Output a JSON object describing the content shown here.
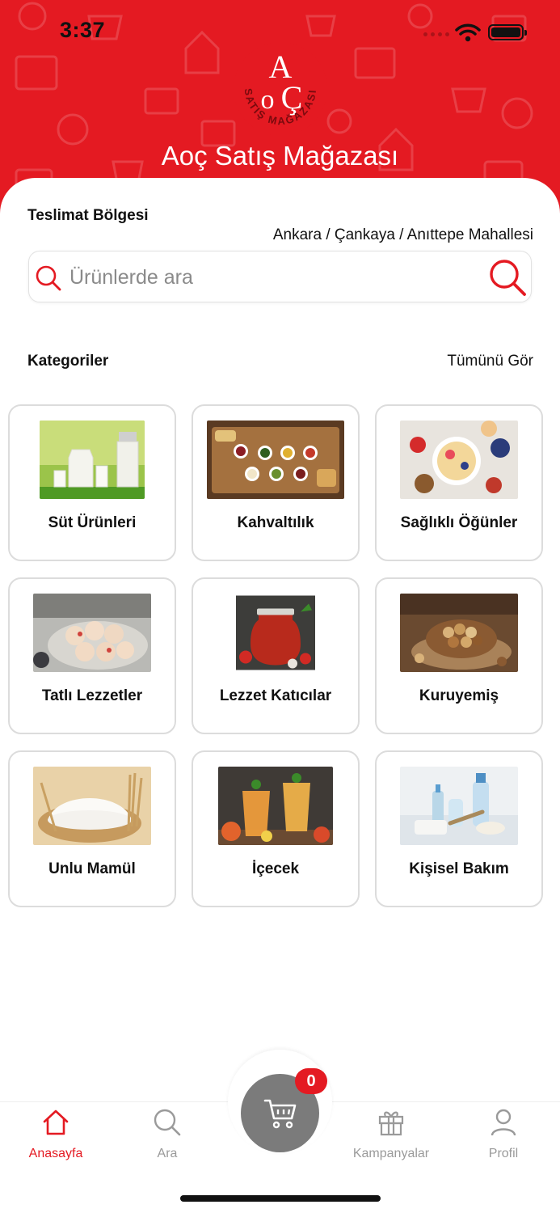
{
  "status_bar": {
    "time": "3:37"
  },
  "header": {
    "logo_text": {
      "monogram": "AOÇ",
      "ring": "SATIŞ MAĞAZASI"
    },
    "title": "Aoç Satış Mağazası",
    "brand_color": "#e41a22"
  },
  "delivery": {
    "title": "Teslimat Bölgesi",
    "address": "Ankara  / Çankaya / Anıttepe Mahallesi"
  },
  "search": {
    "placeholder": "Ürünlerde ara",
    "value": ""
  },
  "categories": {
    "title": "Kategoriler",
    "see_all": "Tümünü Gör",
    "items": [
      {
        "label": "Süt Ürünleri",
        "image": "milk-products-image"
      },
      {
        "label": "Kahvaltılık",
        "image": "breakfast-image"
      },
      {
        "label": "Sağlıklı Öğünler",
        "image": "healthy-meals-image"
      },
      {
        "label": "Tatlı Lezzetler",
        "image": "sweets-image"
      },
      {
        "label": "Lezzet Katıcılar",
        "image": "condiments-image"
      },
      {
        "label": "Kuruyemiş",
        "image": "nuts-image"
      },
      {
        "label": "Unlu Mamül",
        "image": "flour-products-image"
      },
      {
        "label": "İçecek",
        "image": "drinks-image"
      },
      {
        "label": "Kişisel Bakım",
        "image": "personal-care-image"
      }
    ]
  },
  "tabbar": {
    "tabs": [
      {
        "label": "Anasayfa",
        "icon": "home-icon",
        "active": true
      },
      {
        "label": "Ara",
        "icon": "search-icon",
        "active": false
      },
      {
        "label": "Kampanyalar",
        "icon": "gift-icon",
        "active": false
      },
      {
        "label": "Profil",
        "icon": "user-icon",
        "active": false
      }
    ],
    "cart": {
      "count": "0",
      "icon": "cart-icon"
    }
  }
}
